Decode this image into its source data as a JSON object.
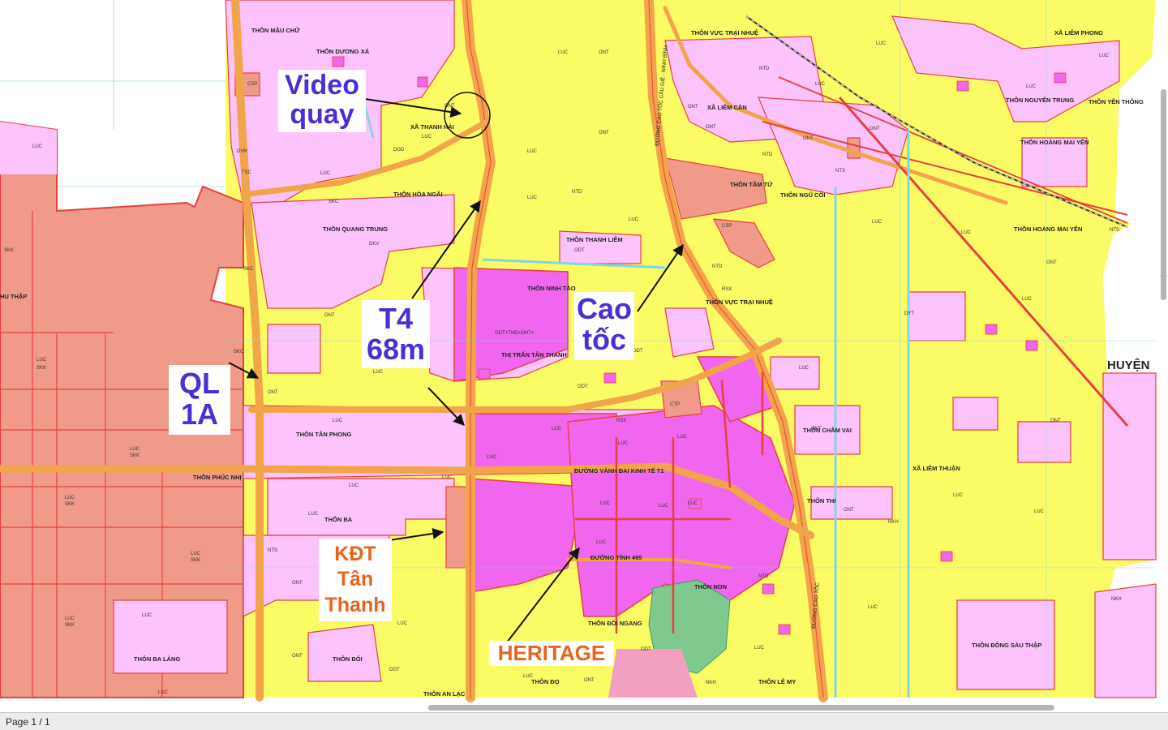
{
  "status": {
    "page_indicator": "Page 1 / 1"
  },
  "colors": {
    "agri_yellow": "#fbfb66",
    "residential_pink": "#fcc3fc",
    "urban_magenta": "#f066ee",
    "industrial_salmon": "#f09a8a",
    "road_orange": "#f2a44a",
    "boundary_red": "#e84040",
    "water_cyan": "#7fd6e4",
    "callout_blue": "#4a2fd6",
    "callout_orange": "#e8641c"
  },
  "callouts": {
    "video": [
      "Video",
      "quay"
    ],
    "t4": [
      "T4",
      "68m"
    ],
    "cao_toc": [
      "Cao",
      "tốc"
    ],
    "ql1a": [
      "QL",
      "1A"
    ],
    "kdt": [
      "KĐT",
      "Tân",
      "Thanh"
    ],
    "heritage": "HERITAGE"
  },
  "map_labels": {
    "thon_mau_chu": "THÔN MẬU CHỮ",
    "thon_duong_xa": "THÔN DƯƠNG XÁ",
    "xa_thanh_hai": "XÃ THANH HẢI",
    "thon_hoa_ngai": "THÔN HÒA NGÃI",
    "thon_quang_trung": "THÔN QUANG TRUNG",
    "thon_thanh_liem": "THÔN THANH LIÊM",
    "thon_ninh_tao": "THÔN NINH TÁO",
    "thi_tran_tan_thanh": "THỊ TRẤN TÂN THANH",
    "thon_vuc_trai_nhue_top": "THÔN VỰC TRẠI NHUỆ",
    "xa_liem_can": "XÃ LIÊM CẦN",
    "thon_tam_tu": "THÔN TÂM TỬ",
    "thon_ngu_coi": "THÔN NGŨ CÔI",
    "thon_vuc_trai_nhue": "THÔN VỰC TRẠI NHUỆ",
    "xa_liem_phong": "XÃ LIÊM PHONG",
    "thon_nguyen_trung": "THÔN NGUYỄN TRUNG",
    "thon_yen_thong": "THÔN YÊN THÔNG",
    "thon_hoang_mai_yen_1": "THÔN HOÀNG MAI YÊN",
    "thon_hoang_mai_yen_2": "THÔN HOÀNG MAI YÊN",
    "huyen": "HUYỆN",
    "thon_tan_phong": "THÔN TÂN PHONG",
    "thon_phuc_nhi": "THÔN PHÚC NHỊ",
    "thu_thap": "HU THẬP",
    "duong_vanh_dai": "ĐƯỜNG VÀNH ĐAI KINH TẾ T1",
    "thon_cham_vai": "THÔN CHÂM VAI",
    "xa_liem_thuan": "XÃ LIÊM THUẬN",
    "thon_thi": "THÔN THI",
    "thon_ba": "THÔN BA",
    "duong_tinh": "ĐƯỜNG TỈNH 495",
    "thon_non": "THÔN NON",
    "thon_doi_ngang": "THÔN ĐỒI NGANG",
    "thon_ba_lang": "THÔN BA LÀNG",
    "thon_boi": "THÔN BỐI",
    "thon_an_lac": "THÔN AN LẠC",
    "thon_do": "THÔN ĐỌ",
    "thon_le_my": "THÔN LÊ MY",
    "thon_dong_sau_thap": "THÔN ĐỒNG SÁU THẬP",
    "cao_toc_road": "ĐƯỜNG CAO TỐC",
    "cau_gie_ninh_binh": "ĐƯỜNG CAO TỐC CẦU GIẼ - NINH BÌNH"
  },
  "codes": {
    "ont": "ONT",
    "luc": "LUC",
    "odt": "ODT",
    "ntd": "NTD",
    "nts": "NTS",
    "skc": "SKC",
    "skk": "SKK",
    "dgt": "DGT",
    "csp": "CSP",
    "nkh": "NKH",
    "dvh": "DVH",
    "tsc": "TSC",
    "dgd": "DGD",
    "tmd": "TMD",
    "rsx": "RSX",
    "dkv": "DKV",
    "ctp": "CTP",
    "tin": "TIN",
    "dyt": "DYT",
    "ddt": "DDT",
    "mixed": "ODT+TMD+DHT+"
  }
}
